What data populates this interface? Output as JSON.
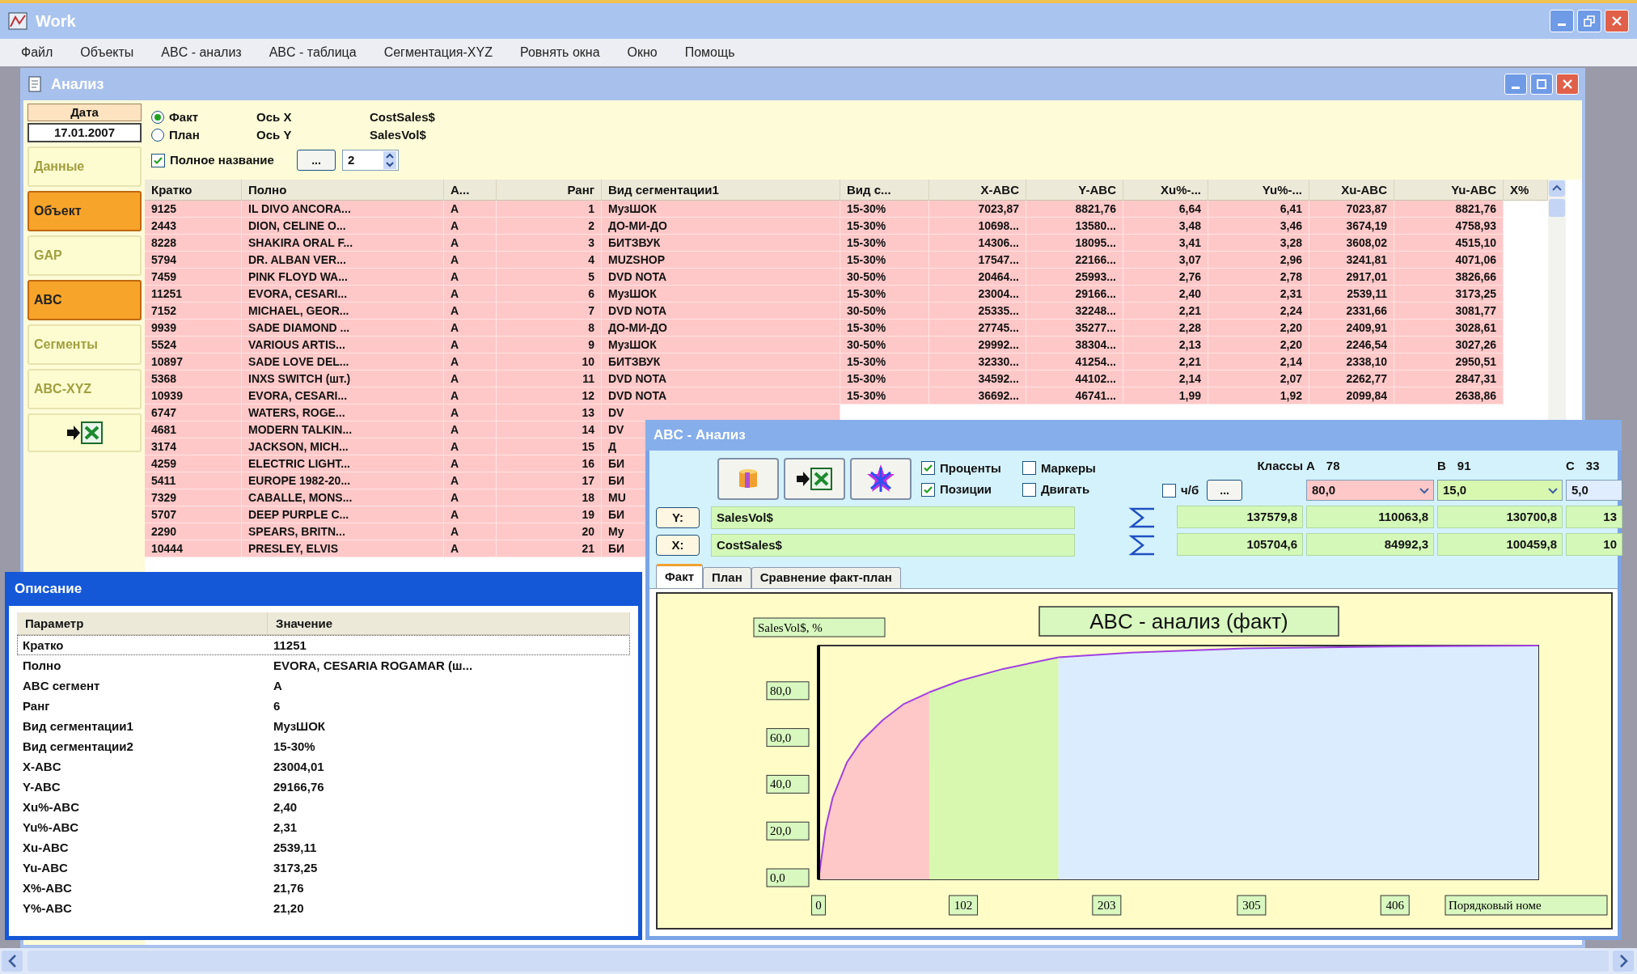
{
  "window": {
    "title": "Work"
  },
  "menu": [
    "Файл",
    "Объекты",
    "ABC - анализ",
    "ABC - таблица",
    "Сегментация-XYZ",
    "Ровнять окна",
    "Окно",
    "Помощь"
  ],
  "analysis_window": {
    "title": "Анализ",
    "date": {
      "label": "Дата",
      "value": "17.01.2007"
    },
    "sidebar": {
      "items": [
        {
          "kind": "text",
          "label": "Данные",
          "active": false
        },
        {
          "kind": "text",
          "label": "Объект",
          "active": true
        },
        {
          "kind": "text",
          "label": "GAP",
          "active": false
        },
        {
          "kind": "text",
          "label": "ABC",
          "active": true
        },
        {
          "kind": "text",
          "label": "Сегменты",
          "active": false
        },
        {
          "kind": "text",
          "label": "ABC-XYZ",
          "active": false
        },
        {
          "kind": "export",
          "active": false
        }
      ]
    },
    "mode": [
      {
        "label": "Факт",
        "selected": true
      },
      {
        "label": "План",
        "selected": false
      }
    ],
    "axes": [
      {
        "label": "Ось X",
        "value": "CostSales$"
      },
      {
        "label": "Ось Y",
        "value": "SalesVol$"
      }
    ],
    "full_name": {
      "label": "Полное название",
      "checked": true
    },
    "browse_button": "...",
    "spinner": {
      "value": "2"
    },
    "table": {
      "columns": [
        "Кратко",
        "Полно",
        "А...",
        "Ранг",
        "Вид сегментации1",
        "Вид с...",
        "X-ABC",
        "Y-ABC",
        "Xu%-...",
        "Yu%-...",
        "Xu-ABC",
        "Yu-ABC",
        "X%"
      ],
      "rows": [
        [
          "9125",
          "IL DIVO ANCORA...",
          "A",
          "1",
          "МузШОК",
          "15-30%",
          "7023,87",
          "8821,76",
          "6,64",
          "6,41",
          "7023,87",
          "8821,76"
        ],
        [
          "2443",
          "DION, CELINE O...",
          "A",
          "2",
          "ДО-МИ-ДО",
          "15-30%",
          "10698...",
          "13580...",
          "3,48",
          "3,46",
          "3674,19",
          "4758,93"
        ],
        [
          "8228",
          "SHAKIRA ORAL F...",
          "A",
          "3",
          "БИТЗВУК",
          "15-30%",
          "14306...",
          "18095...",
          "3,41",
          "3,28",
          "3608,02",
          "4515,10"
        ],
        [
          "5794",
          "DR. ALBAN VER...",
          "A",
          "4",
          "MUZSHOP",
          "15-30%",
          "17547...",
          "22166...",
          "3,07",
          "2,96",
          "3241,81",
          "4071,06"
        ],
        [
          "7459",
          "PINK FLOYD WA...",
          "A",
          "5",
          "DVD NOTA",
          "30-50%",
          "20464...",
          "25993...",
          "2,76",
          "2,78",
          "2917,01",
          "3826,66"
        ],
        [
          "11251",
          "EVORA, CESARI...",
          "A",
          "6",
          "МузШОК",
          "15-30%",
          "23004...",
          "29166...",
          "2,40",
          "2,31",
          "2539,11",
          "3173,25"
        ],
        [
          "7152",
          "MICHAEL, GEOR...",
          "A",
          "7",
          "DVD NOTA",
          "30-50%",
          "25335...",
          "32248...",
          "2,21",
          "2,24",
          "2331,66",
          "3081,77"
        ],
        [
          "9939",
          "SADE DIAMOND ...",
          "A",
          "8",
          "ДО-МИ-ДО",
          "15-30%",
          "27745...",
          "35277...",
          "2,28",
          "2,20",
          "2409,91",
          "3028,61"
        ],
        [
          "5524",
          "VARIOUS ARTIS...",
          "A",
          "9",
          "МузШОК",
          "30-50%",
          "29992...",
          "38304...",
          "2,13",
          "2,20",
          "2246,54",
          "3027,26"
        ],
        [
          "10897",
          "SADE LOVE DEL...",
          "A",
          "10",
          "БИТЗВУК",
          "15-30%",
          "32330...",
          "41254...",
          "2,21",
          "2,14",
          "2338,10",
          "2950,51"
        ],
        [
          "5368",
          "INXS SWITCH (шт.)",
          "A",
          "11",
          "DVD NOTA",
          "15-30%",
          "34592...",
          "44102...",
          "2,14",
          "2,07",
          "2262,77",
          "2847,31"
        ],
        [
          "10939",
          "EVORA, CESARI...",
          "A",
          "12",
          "DVD NOTA",
          "15-30%",
          "36692...",
          "46741...",
          "1,99",
          "1,92",
          "2099,84",
          "2638,86"
        ],
        [
          "6747",
          "WATERS, ROGE...",
          "A",
          "13",
          "DV"
        ],
        [
          "4681",
          "MODERN TALKIN...",
          "A",
          "14",
          "DV"
        ],
        [
          "3174",
          "JACKSON, MICH...",
          "A",
          "15",
          "Д"
        ],
        [
          "4259",
          "ELECTRIC LIGHT...",
          "A",
          "16",
          "БИ"
        ],
        [
          "5411",
          "EUROPE 1982-20...",
          "A",
          "17",
          "БИ"
        ],
        [
          "7329",
          "CABALLE, MONS...",
          "A",
          "18",
          "MU"
        ],
        [
          "5707",
          "DEEP PURPLE C...",
          "A",
          "19",
          "БИ"
        ],
        [
          "2290",
          "SPEARS, BRITN...",
          "A",
          "20",
          "Му"
        ],
        [
          "10444",
          "PRESLEY, ELVIS",
          "A",
          "21",
          "БИ"
        ]
      ]
    }
  },
  "description_window": {
    "title": "Описание",
    "columns": [
      "Параметр",
      "Значение"
    ],
    "rows": [
      {
        "param": "Кратко",
        "value": "11251",
        "selected": true
      },
      {
        "param": "Полно",
        "value": "EVORA, CESARIA ROGAMAR (ш...",
        "selected": false
      },
      {
        "param": "ABC сегмент",
        "value": "A",
        "selected": false
      },
      {
        "param": "Ранг",
        "value": "6",
        "selected": false
      },
      {
        "param": "Вид сегментации1",
        "value": "МузШОК",
        "selected": false
      },
      {
        "param": "Вид сегментации2",
        "value": "15-30%",
        "selected": false
      },
      {
        "param": "X-ABC",
        "value": "23004,01",
        "selected": false
      },
      {
        "param": "Y-ABC",
        "value": "29166,76",
        "selected": false
      },
      {
        "param": "Xu%-ABC",
        "value": "2,40",
        "selected": false
      },
      {
        "param": "Yu%-ABC",
        "value": "2,31",
        "selected": false
      },
      {
        "param": "Xu-ABC",
        "value": "2539,11",
        "selected": false
      },
      {
        "param": "Yu-ABC",
        "value": "3173,25",
        "selected": false
      },
      {
        "param": "X%-ABC",
        "value": "21,76",
        "selected": false
      },
      {
        "param": "Y%-ABC",
        "value": "21,20",
        "selected": false
      }
    ]
  },
  "abc_window": {
    "title": "ABC - Анализ",
    "options": [
      {
        "label": "Проценты",
        "checked": true
      },
      {
        "label": "Позиции",
        "checked": true
      },
      {
        "label": "Маркеры",
        "checked": false
      },
      {
        "label": "Двигать",
        "checked": false
      }
    ],
    "classes_label": "Классы",
    "bw": {
      "label": "ч/б",
      "checked": false
    },
    "classes_button": "...",
    "classes": [
      {
        "label": "A",
        "count": "78",
        "threshold": "80,0",
        "color": "#ffc8c8"
      },
      {
        "label": "B",
        "count": "91",
        "threshold": "15,0",
        "color": "#d8f8b0"
      },
      {
        "label": "C",
        "count": "33",
        "threshold": "5,0",
        "color": "#e0ecff"
      }
    ],
    "axes": [
      {
        "button": "Y:",
        "field": "SalesVol$",
        "sums": [
          "137579,8",
          "110063,8",
          "130700,8",
          "13"
        ]
      },
      {
        "button": "X:",
        "field": "CostSales$",
        "sums": [
          "105704,6",
          "84992,3",
          "100459,8",
          "10"
        ]
      }
    ],
    "tabs": [
      {
        "label": "Факт",
        "selected": true
      },
      {
        "label": "План",
        "selected": false
      },
      {
        "label": "Сравнение факт-план",
        "selected": false
      }
    ],
    "chart_data": {
      "type": "area",
      "title": "ABC - анализ (факт)",
      "xlabel": "Порядковый номе",
      "ylabel": "SalesVol$, %",
      "x": [
        0,
        5,
        10,
        20,
        30,
        45,
        60,
        78,
        100,
        130,
        169,
        220,
        300,
        400,
        507
      ],
      "series": [
        {
          "color": "#ffc8c8",
          "values": [
            0,
            22,
            35,
            50,
            59,
            68,
            75,
            80,
            null,
            null,
            null,
            null,
            null,
            null,
            null
          ]
        },
        {
          "color": "#d8f8b0",
          "values": [
            null,
            null,
            null,
            null,
            null,
            null,
            null,
            80,
            85,
            90,
            95,
            null,
            null,
            null,
            null
          ]
        },
        {
          "color": "#dcecff",
          "values": [
            null,
            null,
            null,
            null,
            null,
            null,
            null,
            null,
            null,
            null,
            95,
            97,
            98.8,
            99.6,
            100
          ]
        }
      ],
      "xlim": [
        0,
        507
      ],
      "ylim": [
        0,
        100
      ],
      "xticks": [
        0,
        102,
        203,
        305,
        406
      ],
      "yticks": [
        {
          "value": 0,
          "label": "0,0"
        },
        {
          "value": 20,
          "label": "20,0"
        },
        {
          "value": 40,
          "label": "40,0"
        },
        {
          "value": 60,
          "label": "60,0"
        },
        {
          "value": 80,
          "label": "80,0"
        }
      ]
    }
  }
}
